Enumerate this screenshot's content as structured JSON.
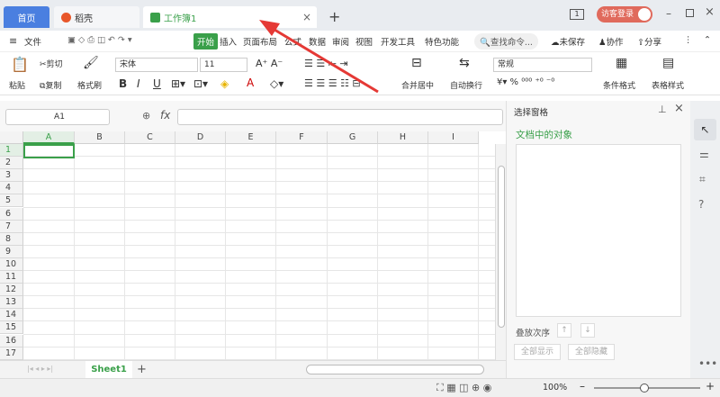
{
  "tabs": {
    "home": "首页",
    "daoke": "稻壳",
    "workbook": "工作簿1"
  },
  "header_right": {
    "page_num": "1",
    "login": "访客登录"
  },
  "menu": {
    "file": "文件",
    "start": "开始",
    "insert": "插入",
    "layout": "页面布局",
    "formula": "公式",
    "data": "数据",
    "review": "审阅",
    "view": "视图",
    "dev": "开发工具",
    "special": "特色功能",
    "search": "查找命令...",
    "unsaved": "未保存",
    "collab": "协作",
    "share": "分享"
  },
  "ribbon": {
    "paste": "粘贴",
    "cut": "剪切",
    "copy": "复制",
    "format_painter": "格式刷",
    "font": "宋体",
    "size": "11",
    "merge": "合并居中",
    "wrap": "自动换行",
    "num_format": "常规",
    "cond_format": "条件格式",
    "table_style": "表格样式"
  },
  "formula_bar": {
    "cell_ref": "A1",
    "fx": "fx"
  },
  "columns": [
    "A",
    "B",
    "C",
    "D",
    "E",
    "F",
    "G",
    "H",
    "I"
  ],
  "rows": [
    "1",
    "2",
    "3",
    "4",
    "5",
    "6",
    "7",
    "8",
    "9",
    "10",
    "11",
    "12",
    "13",
    "14",
    "15",
    "16",
    "17"
  ],
  "sheet": {
    "name": "Sheet1",
    "add": "+"
  },
  "panel": {
    "title": "选择窗格",
    "objects": "文档中的对象",
    "order": "叠放次序",
    "show_all": "全部显示",
    "hide_all": "全部隐藏"
  },
  "status": {
    "zoom": "100%"
  },
  "colors": {
    "accent_green": "#3aa04a",
    "tab_blue": "#4a7fe0",
    "arrow_red": "#e53935"
  }
}
